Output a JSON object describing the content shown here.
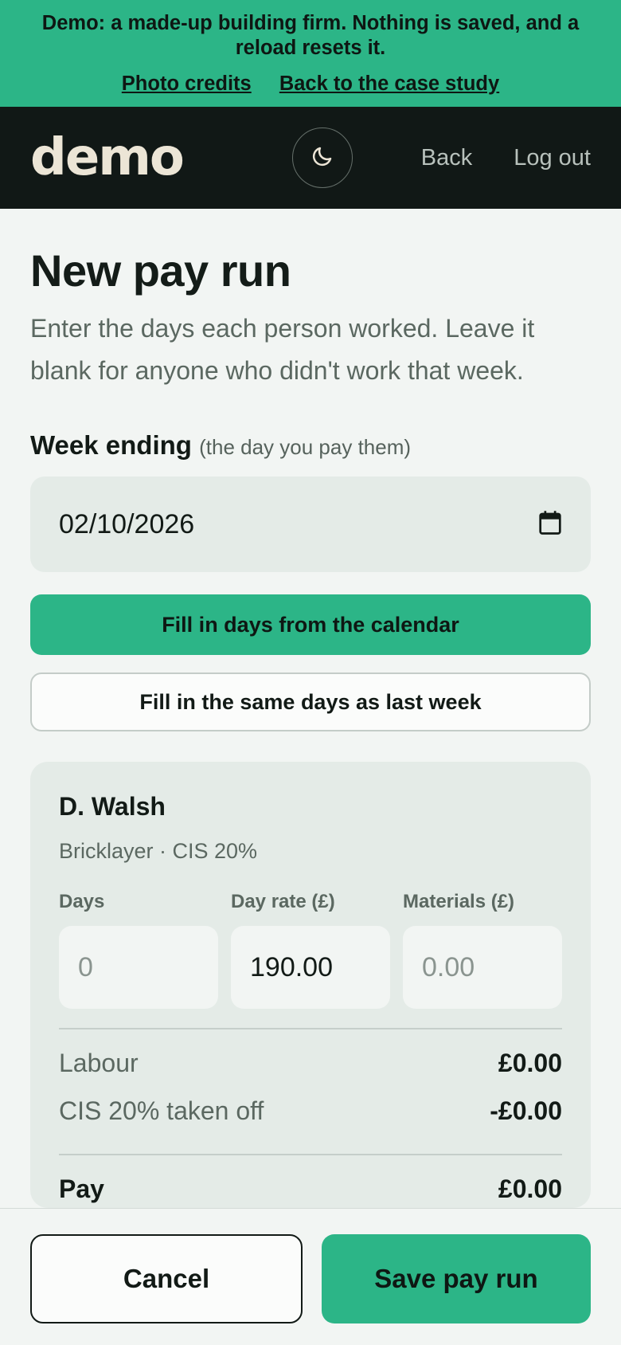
{
  "banner": {
    "message": "Demo: a made-up building firm. Nothing is saved, and a reload resets it.",
    "links": [
      "Photo credits",
      "Back to the case study"
    ]
  },
  "header": {
    "logo": "demo",
    "theme_icon": "moon-icon",
    "nav": [
      "Back",
      "Log out"
    ]
  },
  "page": {
    "title": "New pay run",
    "subtitle": "Enter the days each person worked. Leave it blank for anyone who didn't work that week.",
    "week_label": "Week ending",
    "week_hint": "(the day you pay them)",
    "week_value": "02/10/2026",
    "calendar_icon": "calendar-icon",
    "fill_calendar_label": "Fill in days from the calendar",
    "fill_last_week_label": "Fill in the same days as last week"
  },
  "worker": {
    "name": "D. Walsh",
    "meta": "Bricklayer · CIS 20%",
    "fields": {
      "days_label": "Days",
      "days_placeholder": "0",
      "rate_label": "Day rate (£)",
      "rate_value": "190.00",
      "materials_label": "Materials (£)",
      "materials_placeholder": "0.00"
    },
    "summary": {
      "labour_label": "Labour",
      "labour_value": "£0.00",
      "cis_label": "CIS 20% taken off",
      "cis_value": "-£0.00",
      "pay_label": "Pay",
      "pay_value": "£0.00"
    }
  },
  "footer": {
    "cancel_label": "Cancel",
    "save_label": "Save pay run"
  },
  "colors": {
    "accent": "#2cb587",
    "dark": "#111816",
    "card": "#e4ebe7",
    "background": "#f2f5f3"
  }
}
